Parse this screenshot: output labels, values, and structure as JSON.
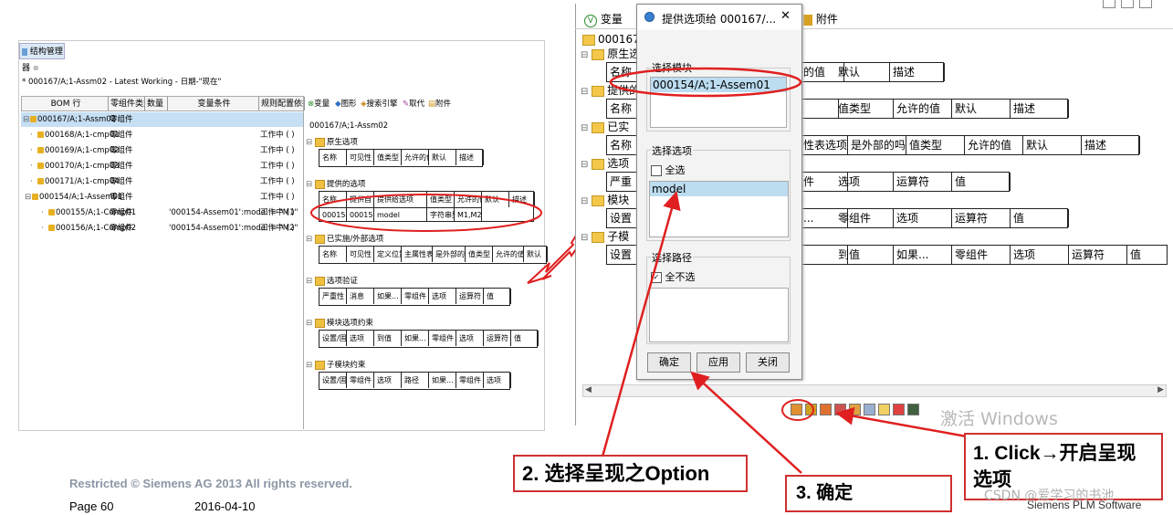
{
  "left": {
    "panel_tab": "结构管理器",
    "tab_close": "⊗",
    "path": "* 000167/A;1-Assm02 - Latest Working - 日期-\"现在\"",
    "headers": [
      "BOM 行",
      "零组件类型",
      "数量",
      "变量条件",
      "规则配置依据"
    ],
    "bom_rows": [
      {
        "prefix": "⊟",
        "label": "000167/A;1-Assm02",
        "type": "零组件",
        "cond": "",
        "rule": "",
        "selected": true
      },
      {
        "prefix": "·",
        "label": "000168/A;1-cmp01",
        "type": "零组件",
        "cond": "",
        "rule": "工作中 ( )"
      },
      {
        "prefix": "·",
        "label": "000169/A;1-cmp02",
        "type": "零组件",
        "cond": "",
        "rule": "工作中 ( )"
      },
      {
        "prefix": "·",
        "label": "000170/A;1-cmp03",
        "type": "零组件",
        "cond": "",
        "rule": "工作中 ( )"
      },
      {
        "prefix": "·",
        "label": "000171/A;1-cmp04",
        "type": "零组件",
        "cond": "",
        "rule": "工作中 ( )"
      },
      {
        "prefix": "⊟",
        "label": "000154/A;1-Assem01",
        "type": "零组件",
        "cond": "",
        "rule": "工作中 ( )"
      },
      {
        "prefix": "·",
        "label": "000155/A;1-Comp01",
        "type": "零组件",
        "cond": "'000154-Assem01':model = \"M1\"",
        "rule": "工作中 ( )"
      },
      {
        "prefix": "·",
        "label": "000156/A;1-Comp02",
        "type": "零组件",
        "cond": "'000154-Assem01':model = \"M2\"",
        "rule": "工作中 ( )"
      }
    ],
    "var_tabs": [
      "变量",
      "图形",
      "搜索引擎",
      "取代",
      "附件"
    ],
    "var_root": "000167/A;1-Assm02",
    "sections": [
      {
        "title": "原生选项",
        "cols": [
          "名称",
          "可见性",
          "值类型",
          "允许的值",
          "默认",
          "描述"
        ]
      },
      {
        "title": "提供的选项",
        "cols": [
          "名称",
          "提供自",
          "提供给选项",
          "值类型",
          "允许的值",
          "默认",
          "描述"
        ],
        "data": [
          "000154...",
          "000154-...",
          "model",
          "字符串型",
          "M1,M2"
        ]
      },
      {
        "title": "已实施/外部选项",
        "cols": [
          "名称",
          "可见性",
          "定义位置",
          "主属性表选项",
          "是外部的吗",
          "值类型",
          "允许的值",
          "默认"
        ]
      },
      {
        "title": "选项验证",
        "cols": [
          "严重性",
          "消息",
          "如果...",
          "零组件",
          "选项",
          "运算符",
          "值"
        ]
      },
      {
        "title": "模块选项约束",
        "cols": [
          "设置/固定",
          "选项",
          "到值",
          "如果...",
          "零组件",
          "选项",
          "运算符",
          "值"
        ]
      },
      {
        "title": "子模块约束",
        "cols": [
          "设置/固定",
          "零组件",
          "选项",
          "路径",
          "如果...",
          "零组件",
          "选项"
        ]
      }
    ]
  },
  "right": {
    "tabs": [
      "变量",
      "附件"
    ],
    "root": "000167",
    "sections": [
      {
        "title": "原生选",
        "cols": [
          "名称",
          "许的值",
          "默认",
          "描述"
        ]
      },
      {
        "title": "提供的",
        "cols": [
          "名称",
          "径",
          "值类型",
          "允许的值",
          "默认",
          "描述"
        ]
      },
      {
        "title": "已实",
        "cols": [
          "名称",
          "属性表选项",
          "是外部的吗",
          "值类型",
          "允许的值",
          "默认",
          "描述"
        ]
      },
      {
        "title": "选项",
        "cols": [
          "严重",
          "组件",
          "选项",
          "运算符",
          "值"
        ]
      },
      {
        "title": "模块",
        "cols": [
          "设置",
          "果...",
          "零组件",
          "选项",
          "运算符",
          "值"
        ]
      },
      {
        "title": "子模",
        "cols": [
          "设置",
          "径",
          "到值",
          "如果...",
          "零组件",
          "选项",
          "运算符",
          "值"
        ]
      }
    ],
    "watermark": "激活 Windows"
  },
  "dialog": {
    "title": "提供选项给 000167/...",
    "close": "✕",
    "module_label": "选择模块",
    "module_value": "000154/A;1-Assem01",
    "option_label": "选择选项",
    "select_all": "全选",
    "option_value": "model",
    "path_label": "选择路径",
    "deselect_all": "全不选",
    "buttons": [
      "确定",
      "应用",
      "关闭"
    ]
  },
  "callouts": {
    "step1": "1. Click→开启呈现选项",
    "step2": "2. 选择呈现之Option",
    "step3": "3. 确定"
  },
  "footer": {
    "restricted": "Restricted © Siemens AG 2013 All rights reserved.",
    "page": "Page 60",
    "date": "2016-04-10",
    "brand": "Siemens PLM Software",
    "csdn": "CSDN @爱学习的书池"
  },
  "colors": {
    "accent_red": "#e02020",
    "selection_blue": "#bcdcf0",
    "folder": "#f0c040"
  }
}
